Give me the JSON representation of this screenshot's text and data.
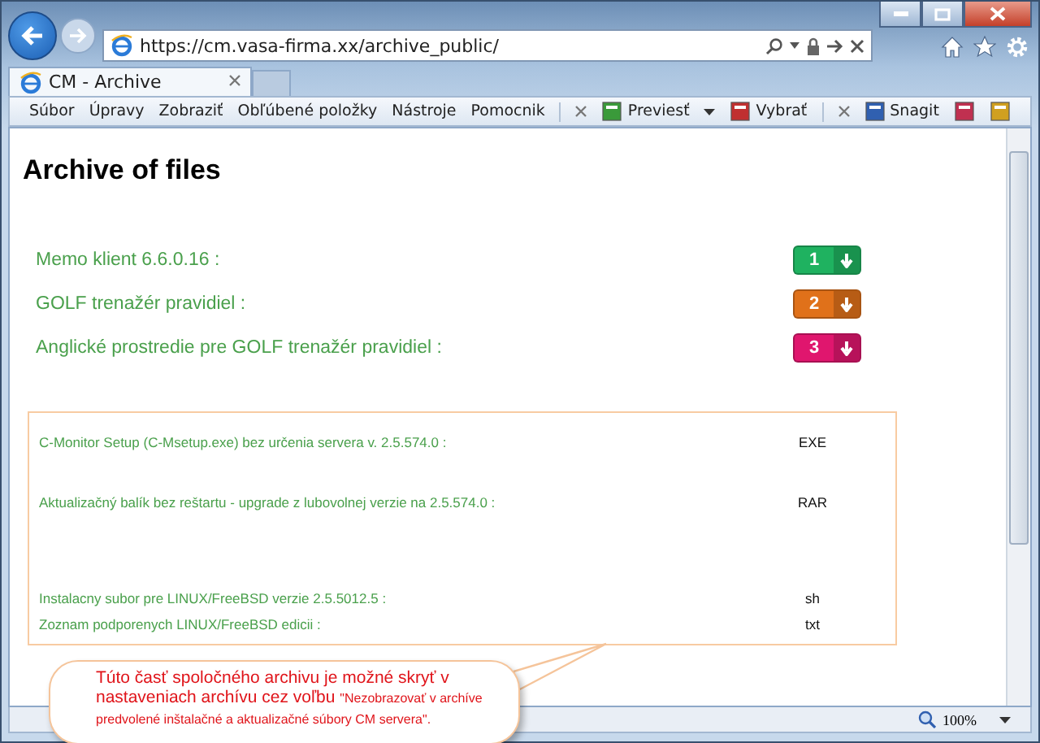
{
  "browser": {
    "url": "https://cm.vasa-firma.xx/archive_public/",
    "tabs": [
      {
        "label": "CM - Archive",
        "selected": true
      }
    ],
    "menu": [
      "Súbor",
      "Úpravy",
      "Zobraziť",
      "Obľúbené položky",
      "Nástroje",
      "Pomocnik"
    ],
    "toolbar": [
      {
        "label": "Previesť",
        "kind": "dropdown"
      },
      {
        "label": "Vybrať",
        "kind": "button"
      },
      {
        "label": "Snagit",
        "kind": "button"
      }
    ],
    "zoom": "100%"
  },
  "page": {
    "title": "Archive of files",
    "downloads": [
      {
        "label": "Memo klient 6.6.0.16 :",
        "number": "1",
        "color": "#1fb260"
      },
      {
        "label": "GOLF trenažér pravidiel :",
        "number": "2",
        "color": "#e0711a"
      },
      {
        "label": "Anglické prostredie pre GOLF trenažér pravidiel :",
        "number": "3",
        "color": "#e0166e"
      }
    ],
    "files": [
      {
        "label": "C-Monitor Setup (C-Msetup.exe) bez určenia servera v. 2.5.574.0 :",
        "type": "EXE"
      },
      {
        "label": "Aktualizačný balík bez reštartu - upgrade z lubovolnej verzie na 2.5.574.0 :",
        "type": "RAR"
      },
      {
        "label": "Instalacny subor pre LINUX/FreeBSD verzie 2.5.5012.5 :",
        "type": "sh"
      },
      {
        "label": "Zoznam podporenych LINUX/FreeBSD edicii :",
        "type": "txt"
      }
    ]
  },
  "callout": {
    "text": "Túto časť spoločného archivu je možné skryť v nastaveniach archívu cez voľbu",
    "quote": "\"Nezobrazovať v archíve predvolené inštalačné a aktualizačné súbory CM servera\"."
  }
}
